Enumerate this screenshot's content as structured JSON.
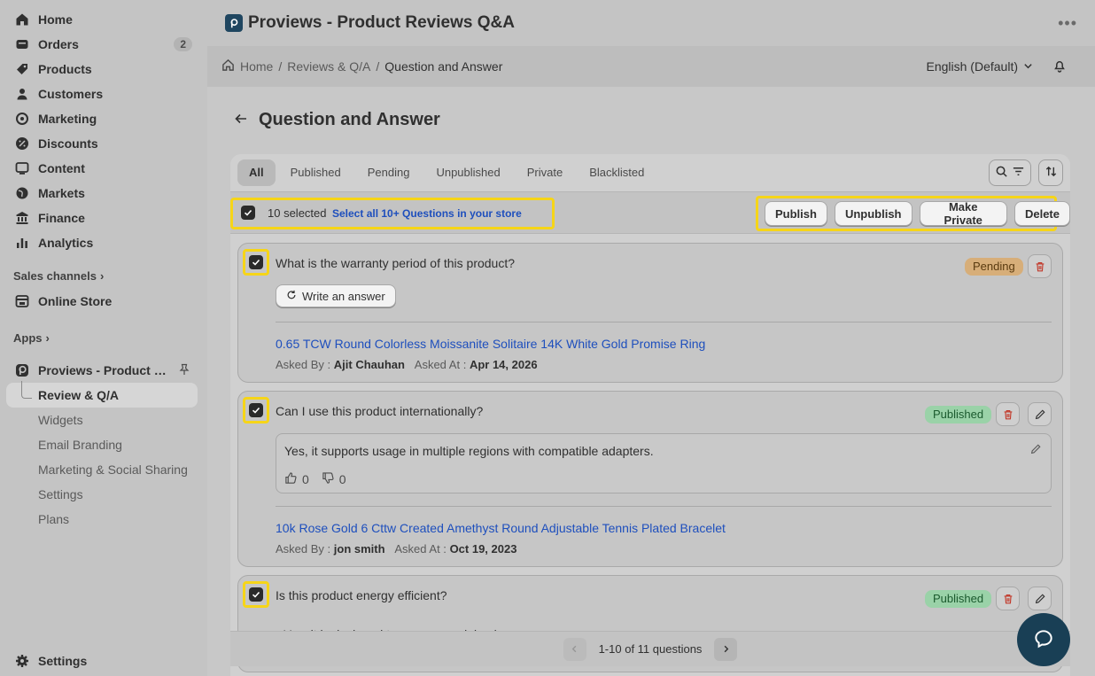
{
  "sidebar": {
    "items": [
      {
        "label": "Home",
        "icon": "home-icon"
      },
      {
        "label": "Orders",
        "icon": "orders-icon",
        "count": "2"
      },
      {
        "label": "Products",
        "icon": "tag-icon"
      },
      {
        "label": "Customers",
        "icon": "person-icon"
      },
      {
        "label": "Marketing",
        "icon": "target-icon"
      },
      {
        "label": "Discounts",
        "icon": "discount-icon"
      },
      {
        "label": "Content",
        "icon": "content-icon"
      },
      {
        "label": "Markets",
        "icon": "globe-icon"
      },
      {
        "label": "Finance",
        "icon": "bank-icon"
      },
      {
        "label": "Analytics",
        "icon": "chart-bar-icon"
      }
    ],
    "sales_channels": "Sales channels",
    "online_store": "Online Store",
    "apps": "Apps",
    "app_name": "Proviews - Product Re...",
    "app_subitems": [
      "Review & Q/A",
      "Widgets",
      "Email Branding",
      "Marketing & Social Sharing",
      "Settings",
      "Plans"
    ],
    "settings": "Settings"
  },
  "header": {
    "app_title": "Proviews - Product Reviews Q&A",
    "breadcrumb": [
      "Home",
      "Reviews & Q/A",
      "Question and Answer"
    ],
    "language": "English (Default)"
  },
  "page": {
    "title": "Question and Answer",
    "tabs": [
      "All",
      "Published",
      "Pending",
      "Unpublished",
      "Private",
      "Blacklisted"
    ],
    "selected_count": "10 selected",
    "select_all": "Select all 10+ Questions in your store",
    "bulk_actions": [
      "Publish",
      "Unpublish",
      "Make Private",
      "Delete"
    ],
    "pagination": "1-10 of 11 questions"
  },
  "questions": [
    {
      "question": "What is the warranty period of this product?",
      "status": "Pending",
      "write_answer": "Write an answer",
      "product": "0.65 TCW Round Colorless Moissanite Solitaire 14K White Gold Promise Ring",
      "asked_by_label": "Asked By :",
      "asked_by": "Ajit Chauhan",
      "asked_at_label": "Asked At :",
      "asked_at": "Apr 14, 2026"
    },
    {
      "question": "Can I use this product internationally?",
      "status": "Published",
      "answer": "Yes, it supports usage in multiple regions with compatible adapters.",
      "likes": "0",
      "dislikes": "0",
      "product": "10k Rose Gold 6 Cttw Created Amethyst Round Adjustable Tennis Plated Bracelet",
      "asked_by_label": "Asked By :",
      "asked_by": "jon smith",
      "asked_at_label": "Asked At :",
      "asked_at": "Oct 19, 2023"
    },
    {
      "question": "Is this product energy efficient?",
      "status": "Published",
      "answer": "Yes, it is designed to consume minimal power."
    }
  ],
  "colors": {
    "highlight": "#f6d518",
    "link": "#1e4fbd",
    "pending_badge": "#d7ae79",
    "published_badge": "#9ad2a8",
    "chat_bubble": "#193f55"
  }
}
